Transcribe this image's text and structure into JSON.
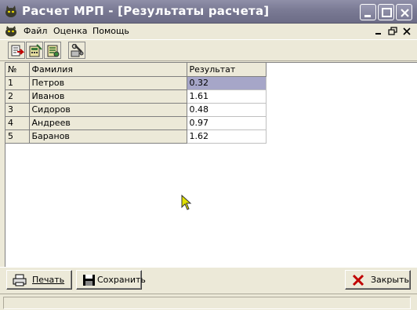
{
  "window": {
    "title": "Расчет МРП - [Результаты расчета]"
  },
  "menu": {
    "items": [
      {
        "label": "Файл"
      },
      {
        "label": "Оценка"
      },
      {
        "label": "Помощь"
      }
    ]
  },
  "toolbar": {
    "buttons": [
      {
        "icon": "export-icon"
      },
      {
        "icon": "calculate-icon"
      },
      {
        "icon": "results-icon"
      },
      {
        "icon": "settings-icon"
      }
    ]
  },
  "grid": {
    "columns": [
      "№",
      "Фамилия",
      "Результат"
    ],
    "rows": [
      {
        "num": "1",
        "name": "Петров",
        "result": "0.32"
      },
      {
        "num": "2",
        "name": "Иванов",
        "result": "1.61"
      },
      {
        "num": "3",
        "name": "Сидоров",
        "result": "0.48"
      },
      {
        "num": "4",
        "name": "Андреев",
        "result": "0.97"
      },
      {
        "num": "5",
        "name": "Баранов",
        "result": "1.62"
      }
    ],
    "selected_row": 0
  },
  "buttons": {
    "print_label": "Печать",
    "save_label": "Сохранить",
    "close_label": "Закрыть"
  },
  "colors": {
    "titlebar": "#7a7a94",
    "selection": "#a6a6c8",
    "close_x": "#c00000"
  }
}
